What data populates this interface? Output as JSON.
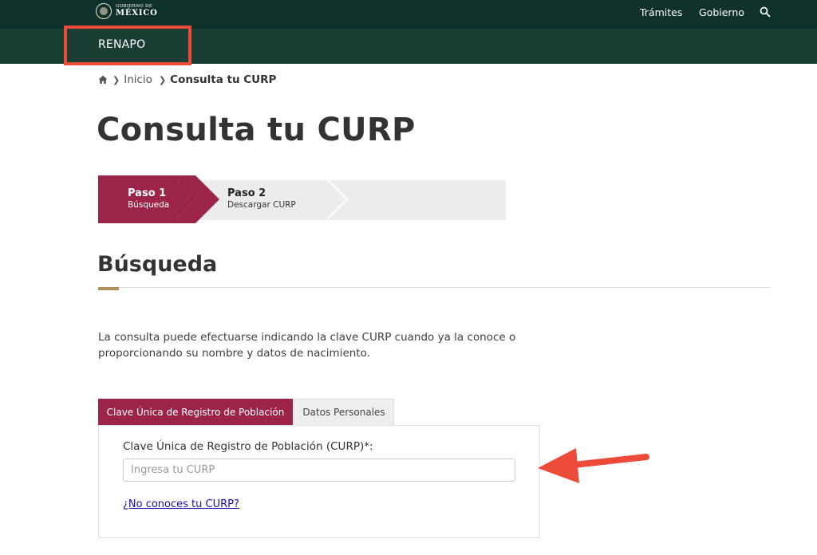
{
  "header": {
    "logo": {
      "line1": "GOBIERNO DE",
      "line2": "MÉXICO"
    },
    "nav": {
      "tramites": "Trámites",
      "gobierno": "Gobierno"
    },
    "search_icon": "search-icon",
    "subnav_title": "RENAPO"
  },
  "breadcrumb": {
    "home_icon": "home-icon",
    "items": [
      "Inicio",
      "Consulta tu CURP"
    ]
  },
  "page_title": "Consulta tu CURP",
  "stepper": {
    "steps": [
      {
        "title": "Paso 1",
        "subtitle": "Búsqueda",
        "active": true
      },
      {
        "title": "Paso 2",
        "subtitle": "Descargar CURP",
        "active": false
      }
    ]
  },
  "section": {
    "title": "Búsqueda",
    "intro": "La consulta puede efectuarse indicando la clave CURP cuando ya la conoce o proporcionando su nombre y datos de nacimiento."
  },
  "tabs": [
    {
      "label": "Clave Única de Registro de Población",
      "active": true
    },
    {
      "label": "Datos Personales",
      "active": false
    }
  ],
  "form": {
    "curp_label": "Clave Única de Registro de Población (CURP)*:",
    "curp_value": "",
    "curp_placeholder": "Ingresa tu CURP",
    "help_link": "¿No conoces tu CURP?"
  },
  "colors": {
    "topbar": "#10312b",
    "subbar": "#1a3d34",
    "primary": "#9d2449",
    "accent_gold": "#b38e5d",
    "annotation_red": "#ec4b3a"
  }
}
